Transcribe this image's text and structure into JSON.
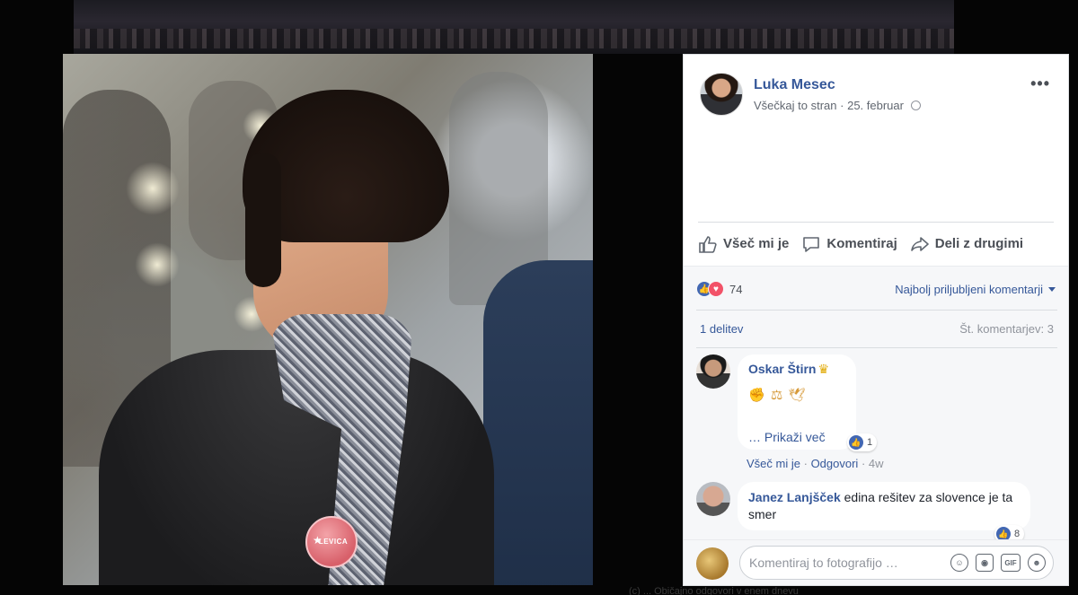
{
  "post": {
    "author": "Luka Mesec",
    "audience": "Všečkaj to stran",
    "separator": "·",
    "date": "25. februar",
    "options_icon": "more-dots-icon",
    "privacy_icon": "globe-icon"
  },
  "actions": {
    "like": "Všeč mi je",
    "comment": "Komentiraj",
    "share": "Deli z drugimi"
  },
  "stats": {
    "reaction_count": "74",
    "reaction_icons": [
      "like-icon",
      "love-icon"
    ],
    "sort_label": "Najbolj priljubljeni komentarji",
    "shares": "1 delitev",
    "comment_count": "Št. komentarjev: 3"
  },
  "comments": [
    {
      "name": "Oskar Štirn",
      "badge_icon": "crown-icon",
      "emoji": "✊ ⚖ 🕊",
      "more": "… Prikaži več",
      "likes": "1",
      "actions": {
        "like": "Všeč mi je",
        "sep": "·",
        "reply": "Odgovori",
        "ago": "4w"
      }
    },
    {
      "name": "Janez Lanjšček",
      "text": "edina rešitev za slovence je ta smer",
      "likes": "8"
    }
  ],
  "composer": {
    "placeholder": "Komentiraj to fotografijo …",
    "icons": [
      "emoji-icon",
      "camera-icon",
      "gif-icon",
      "sticker-icon"
    ],
    "gif_label": "GIF"
  },
  "photo": {
    "badge_text": "LEVICA"
  },
  "caption": "(c) ... Običajno odgovori v enem dnevu"
}
